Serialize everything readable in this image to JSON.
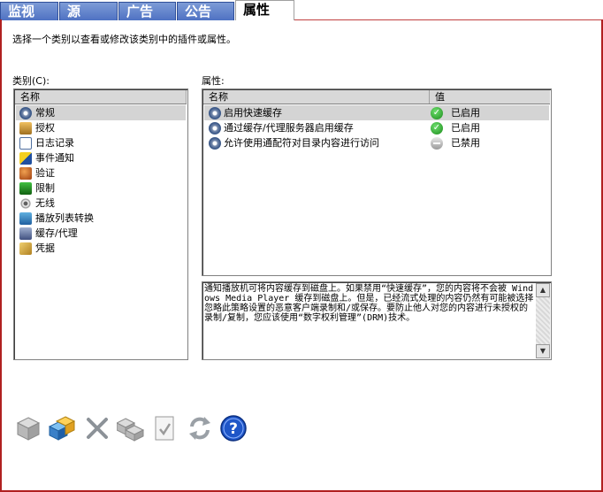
{
  "tabs": [
    {
      "label": "监视"
    },
    {
      "label": "源"
    },
    {
      "label": "广告"
    },
    {
      "label": "公告"
    },
    {
      "label": "属性"
    }
  ],
  "description": "选择一个类别以查看或修改该类别中的插件或属性。",
  "categories": {
    "label": "类别(C):",
    "header": "名称",
    "items": [
      {
        "label": "常规",
        "icon": "gear-icon"
      },
      {
        "label": "授权",
        "icon": "lock-icon"
      },
      {
        "label": "日志记录",
        "icon": "log-icon"
      },
      {
        "label": "事件通知",
        "icon": "event-icon"
      },
      {
        "label": "验证",
        "icon": "users-icon"
      },
      {
        "label": "限制",
        "icon": "limit-icon"
      },
      {
        "label": "无线",
        "icon": "wireless-icon"
      },
      {
        "label": "播放列表转换",
        "icon": "playlist-icon"
      },
      {
        "label": "缓存/代理",
        "icon": "cache-icon"
      },
      {
        "label": "凭据",
        "icon": "key-icon"
      }
    ]
  },
  "properties": {
    "label": "属性:",
    "col_name": "名称",
    "col_value": "值",
    "rows": [
      {
        "name": "启用快速缓存",
        "value": "已启用",
        "status": "enabled"
      },
      {
        "name": "通过缓存/代理服务器启用缓存",
        "value": "已启用",
        "status": "enabled"
      },
      {
        "name": "允许使用通配符对目录内容进行访问",
        "value": "已禁用",
        "status": "disabled"
      }
    ]
  },
  "info_text": "通知播放机可将内容缓存到磁盘上。如果禁用“快速缓存”，您的内容将不会被 Windows Media Player 缓存到磁盘上。但是，已经流式处理的内容仍然有可能被选择忽略此策略设置的恶意客户端录制和/或保存。要防止他人对您的内容进行未授权的录制/复制，您应该使用“数字权利管理”(DRM)技术。",
  "toolbar": [
    {
      "icon": "cube-icon"
    },
    {
      "icon": "add-plugin-icon"
    },
    {
      "icon": "delete-icon"
    },
    {
      "icon": "copy-icon"
    },
    {
      "icon": "properties-icon"
    },
    {
      "icon": "refresh-icon"
    },
    {
      "icon": "help-icon"
    }
  ]
}
